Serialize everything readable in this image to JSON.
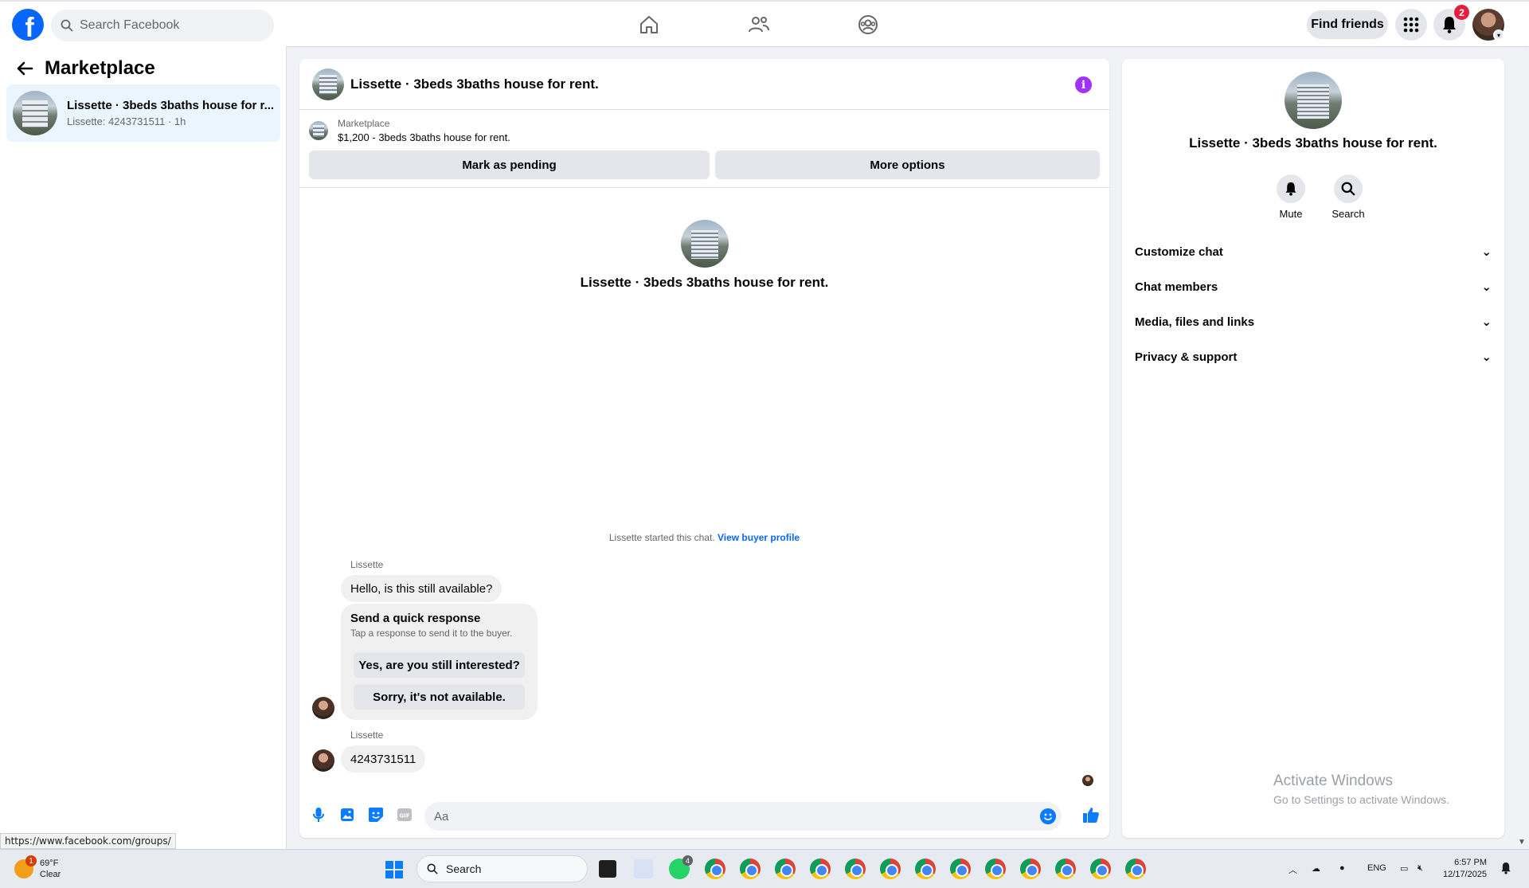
{
  "topnav": {
    "search_placeholder": "Search Facebook",
    "find_friends": "Find friends",
    "notification_count": "2"
  },
  "left": {
    "title": "Marketplace",
    "conversation": {
      "title": "Lissette · 3beds 3baths house for r...",
      "subtitle": "Lissette: 4243731511 · 1h"
    }
  },
  "status_url": "https://www.facebook.com/groups/",
  "chat": {
    "header_title": "Lissette · 3beds 3baths house for rent.",
    "listing_label": "Marketplace",
    "listing_price": "$1,200 - 3beds 3baths house for rent.",
    "mark_pending": "Mark as pending",
    "more_options": "More options",
    "center_title": "Lissette · 3beds 3baths house for rent.",
    "started_text": "Lissette started this chat.",
    "view_buyer": "View buyer profile",
    "messages": [
      {
        "sender": "Lissette",
        "text": "Hello, is this still available?"
      },
      {
        "sender": "Lissette",
        "text": "4243731511"
      }
    ],
    "quick": {
      "title": "Send a quick response",
      "subtitle": "Tap a response to send it to the buyer.",
      "option1": "Yes, are you still interested?",
      "option2": "Sorry, it's not available."
    },
    "composer_placeholder": "Aa"
  },
  "right": {
    "title": "Lissette · 3beds 3baths house for rent.",
    "mute": "Mute",
    "search": "Search",
    "rows": [
      "Customize chat",
      "Chat members",
      "Media, files and links",
      "Privacy & support"
    ],
    "activate_title": "Activate Windows",
    "activate_sub": "Go to Settings to activate Windows."
  },
  "taskbar": {
    "weather_badge": "1",
    "temp": "69°F",
    "condition": "Clear",
    "search": "Search",
    "whatsapp_badge": "4",
    "lang": "ENG",
    "time": "6:57 PM",
    "date": "12/17/2025"
  },
  "colors": {
    "brand": "#0866ff",
    "info": "#a033ff",
    "badge": "#e41e3f"
  }
}
